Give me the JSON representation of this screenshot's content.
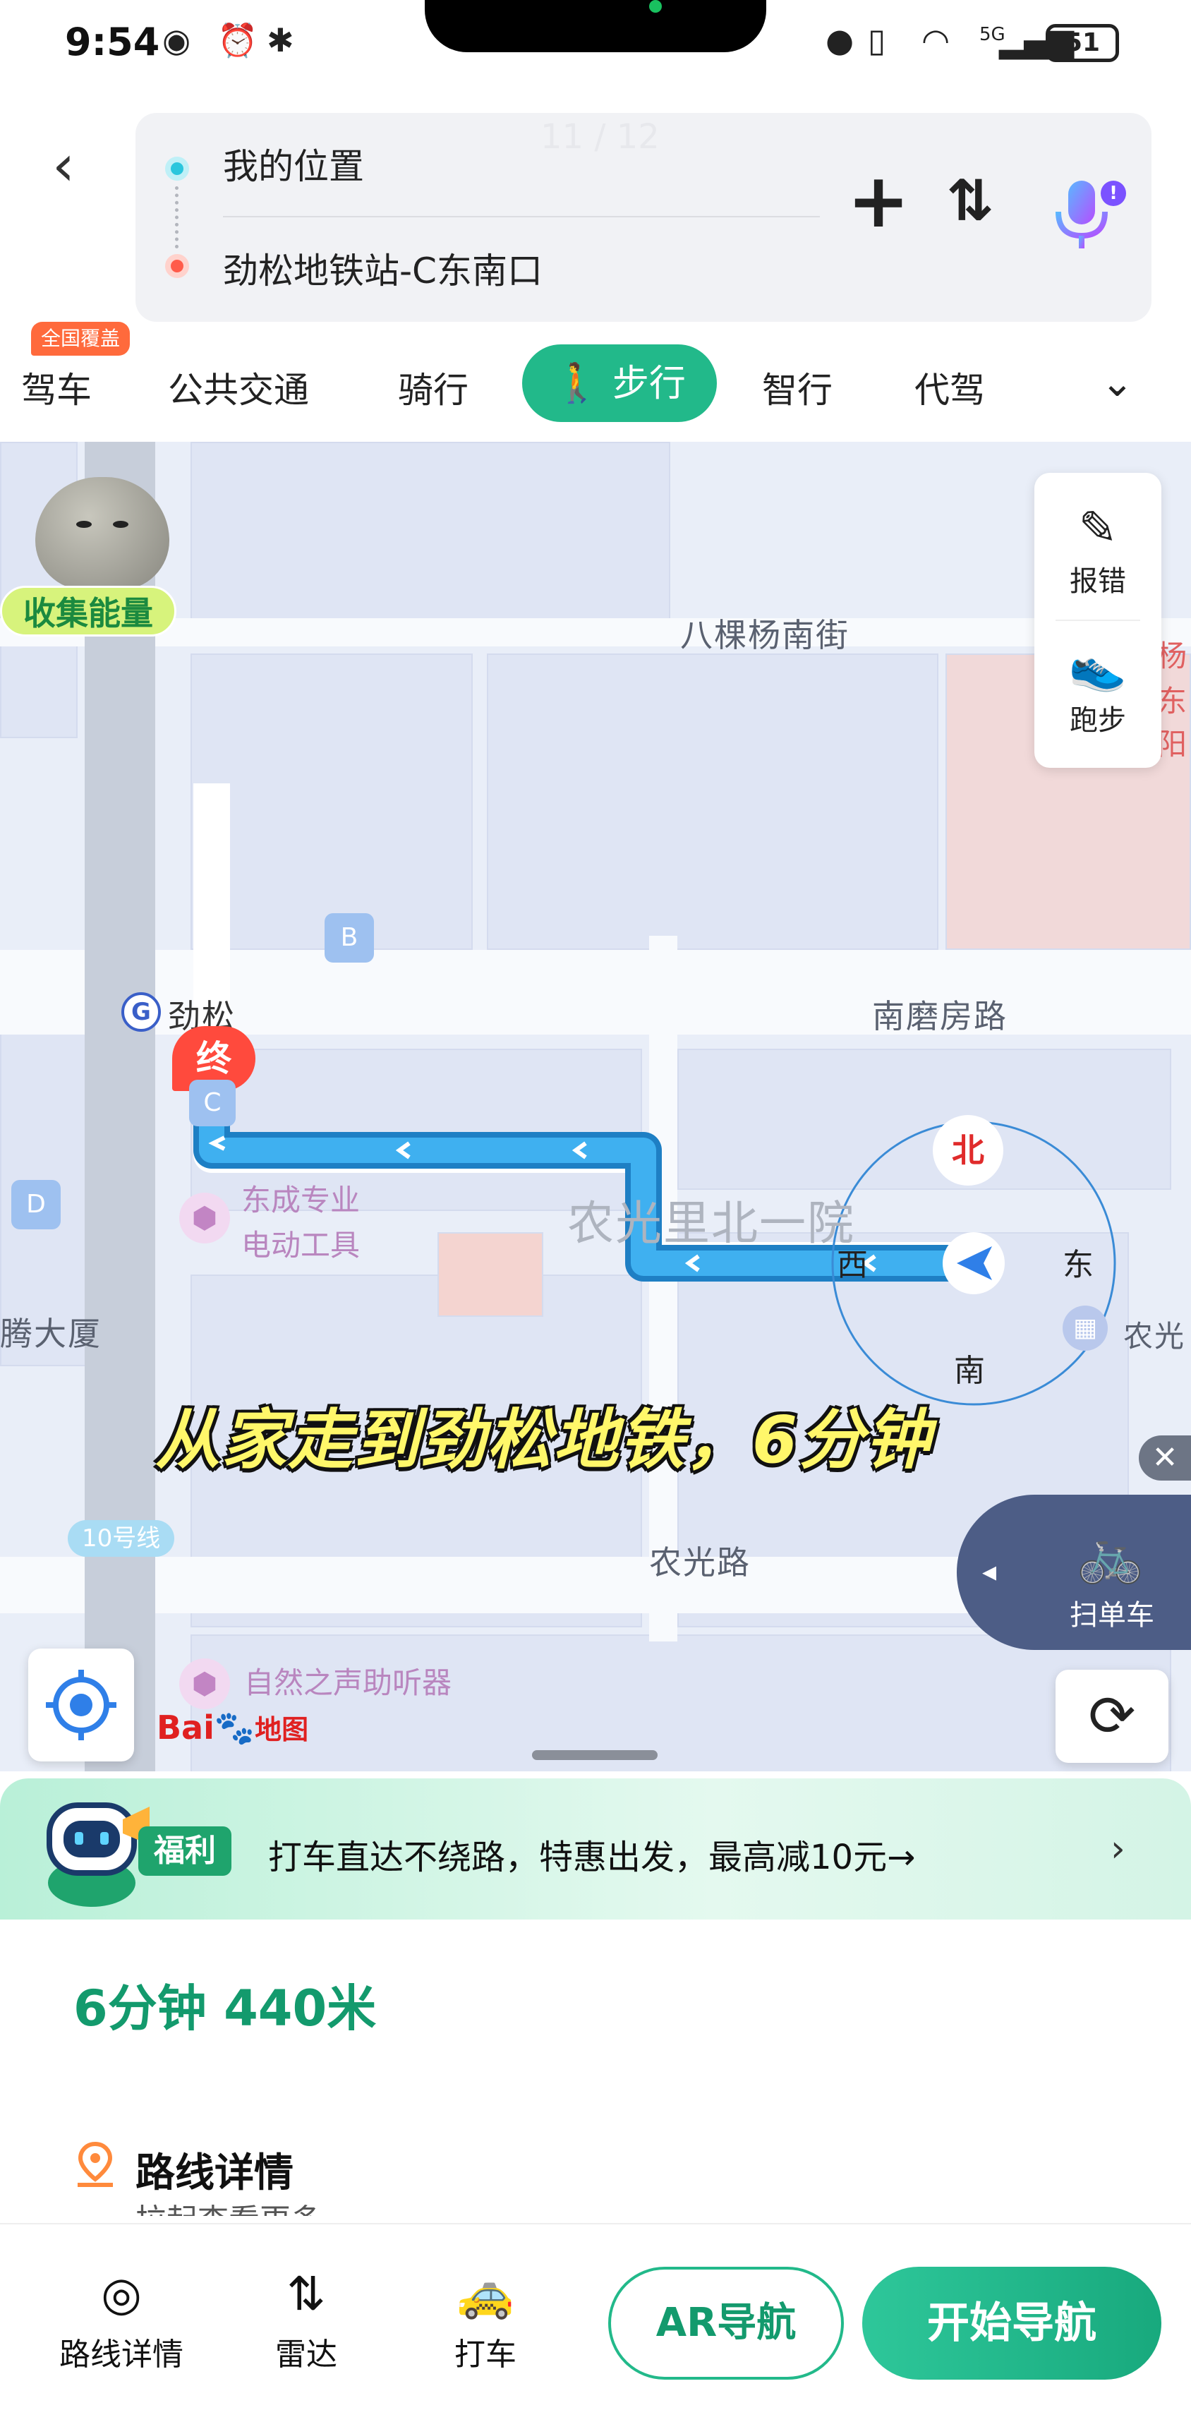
{
  "status_bar": {
    "time": "9:54",
    "network": "5G",
    "battery": "51"
  },
  "header": {
    "start": "我的位置",
    "end": "劲松地铁站-C东南口",
    "page_counter": "11 / 12"
  },
  "tabs": {
    "badge": "全国覆盖",
    "items": [
      "驾车",
      "公共交通",
      "骑行",
      "步行",
      "智行",
      "代驾"
    ],
    "active": "步行"
  },
  "map": {
    "side_buttons": [
      {
        "label": "报错",
        "icon": "edit-icon"
      },
      {
        "label": "跑步",
        "icon": "running-shoe-icon"
      }
    ],
    "energy_label": "收集能量",
    "streets": [
      "八棵杨南街",
      "南磨房路",
      "农光路"
    ],
    "station": "劲松",
    "end_marker": "终",
    "poi": [
      "东成专业",
      "电动工具",
      "农光里北一院",
      "腾大厦",
      "自然之声助听器",
      "农光",
      "杨",
      "东阳"
    ],
    "line_label": "10号线",
    "bus_label": "B",
    "exit_c": "C",
    "exit_d": "D",
    "compass": {
      "n": "北",
      "e": "东",
      "s": "南",
      "w": "西"
    },
    "caption": "从家走到劲松地铁，6分钟",
    "scan_bike": "扫单车",
    "logo_text": "地图",
    "logo_brand": "Bai"
  },
  "promo": {
    "tag": "福利",
    "text": "打车直达不绕路，特惠出发，最高减10元→"
  },
  "route": {
    "summary": "6分钟 440米",
    "detail_title": "路线详情",
    "detail_sub": "拉起查看更多"
  },
  "bottom": {
    "items": [
      {
        "label": "路线详情",
        "icon": "location-pin-icon"
      },
      {
        "label": "雷达",
        "icon": "radar-icon"
      },
      {
        "label": "打车",
        "icon": "taxi-icon"
      }
    ],
    "ar_button": "AR导航",
    "start_button": "开始导航"
  },
  "colors": {
    "accent": "#22b98a",
    "route": "#3aa6ec",
    "danger": "#ff5b4a"
  }
}
